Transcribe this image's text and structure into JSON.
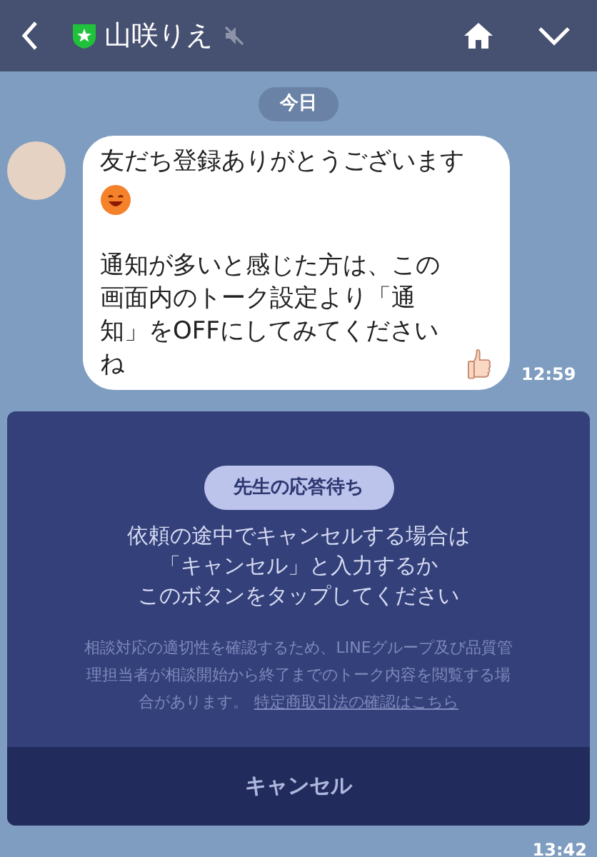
{
  "header": {
    "title": "山咲りえ",
    "muted": true
  },
  "date_label": "今日",
  "messages": [
    {
      "kind": "text",
      "line_1": "友だち登録ありがとうございます",
      "line_2": "通知が多いと感じた方は、この画面内のトーク設定より「通知」をOFFにしてみてくださいね",
      "time": "12:59"
    },
    {
      "kind": "card",
      "status": "先生の応答待ち",
      "lines": [
        "依頼の途中でキャンセルする場合は",
        "「キャンセル」と入力するか",
        "このボタンをタップしてください"
      ],
      "note": "相談対応の適切性を確認するため、LINEグループ及び品質管理担当者が相談開始から終了までのトーク内容を閲覧する場合があります。",
      "link": "特定商取引法の確認はこちら",
      "button": "キャンセル",
      "time": "13:42"
    }
  ]
}
